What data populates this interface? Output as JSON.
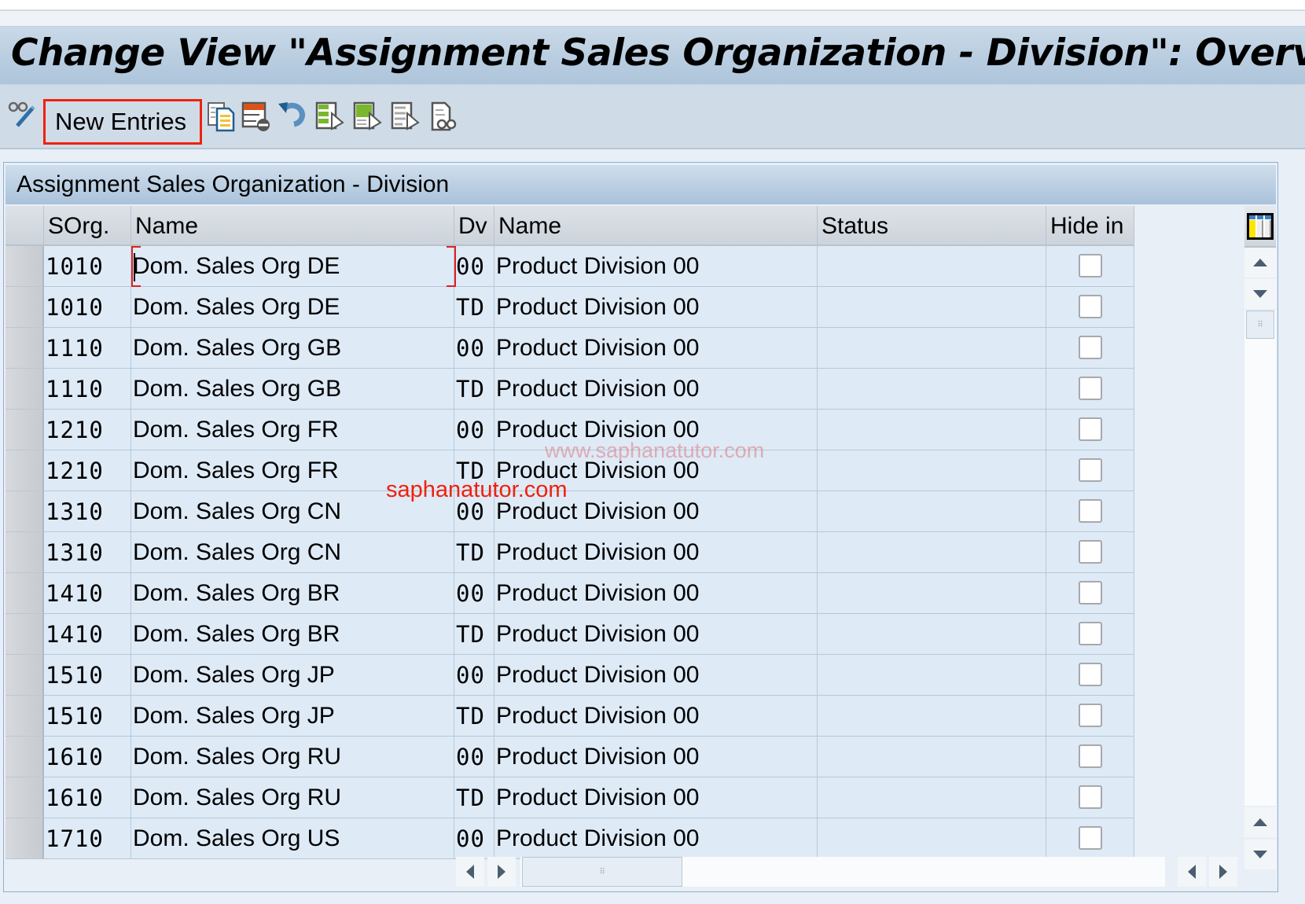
{
  "window": {
    "title": "Change View \"Assignment Sales Organization - Division\": Overview"
  },
  "toolbar": {
    "new_entries_label": "New Entries",
    "icons": [
      "display-change-icon",
      "copy-as-icon",
      "delete-icon",
      "undo-icon",
      "select-all-icon",
      "select-block-icon",
      "deselect-all-icon",
      "print-icon"
    ]
  },
  "table": {
    "title": "Assignment Sales Organization - Division",
    "columns": [
      "SOrg.",
      "Name",
      "Dv",
      "Name",
      "Status",
      "Hide in"
    ],
    "rows": [
      {
        "sorg": "1010",
        "name": "Dom. Sales Org DE",
        "dv": "00",
        "div_name": "Product Division 00",
        "status": "",
        "hide": false
      },
      {
        "sorg": "1010",
        "name": "Dom. Sales Org DE",
        "dv": "TD",
        "div_name": "Product Division 00",
        "status": "",
        "hide": false
      },
      {
        "sorg": "1110",
        "name": "Dom. Sales Org GB",
        "dv": "00",
        "div_name": "Product Division 00",
        "status": "",
        "hide": false
      },
      {
        "sorg": "1110",
        "name": "Dom. Sales Org GB",
        "dv": "TD",
        "div_name": "Product Division 00",
        "status": "",
        "hide": false
      },
      {
        "sorg": "1210",
        "name": "Dom. Sales Org FR",
        "dv": "00",
        "div_name": "Product Division 00",
        "status": "",
        "hide": false
      },
      {
        "sorg": "1210",
        "name": "Dom. Sales Org FR",
        "dv": "TD",
        "div_name": "Product Division 00",
        "status": "",
        "hide": false
      },
      {
        "sorg": "1310",
        "name": "Dom. Sales Org CN",
        "dv": "00",
        "div_name": "Product Division 00",
        "status": "",
        "hide": false
      },
      {
        "sorg": "1310",
        "name": "Dom. Sales Org CN",
        "dv": "TD",
        "div_name": "Product Division 00",
        "status": "",
        "hide": false
      },
      {
        "sorg": "1410",
        "name": "Dom. Sales Org BR",
        "dv": "00",
        "div_name": "Product Division 00",
        "status": "",
        "hide": false
      },
      {
        "sorg": "1410",
        "name": "Dom. Sales Org BR",
        "dv": "TD",
        "div_name": "Product Division 00",
        "status": "",
        "hide": false
      },
      {
        "sorg": "1510",
        "name": "Dom. Sales Org JP",
        "dv": "00",
        "div_name": "Product Division 00",
        "status": "",
        "hide": false
      },
      {
        "sorg": "1510",
        "name": "Dom. Sales Org JP",
        "dv": "TD",
        "div_name": "Product Division 00",
        "status": "",
        "hide": false
      },
      {
        "sorg": "1610",
        "name": "Dom. Sales Org RU",
        "dv": "00",
        "div_name": "Product Division 00",
        "status": "",
        "hide": false
      },
      {
        "sorg": "1610",
        "name": "Dom. Sales Org RU",
        "dv": "TD",
        "div_name": "Product Division 00",
        "status": "",
        "hide": false
      },
      {
        "sorg": "1710",
        "name": "Dom. Sales Org US",
        "dv": "00",
        "div_name": "Product Division 00",
        "status": "",
        "hide": false
      }
    ]
  },
  "watermarks": {
    "primary": "www.saphanatutor.com",
    "secondary": "saphanatutor.com"
  },
  "colors": {
    "highlight_box": "#f0210c",
    "row_bg": "#deeaf6",
    "title_bar": "#adc4da"
  }
}
